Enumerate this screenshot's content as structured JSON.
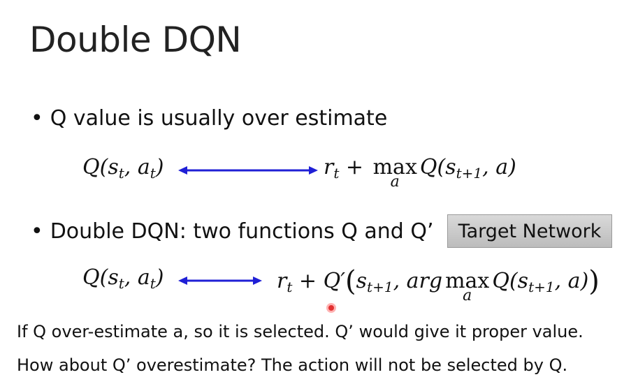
{
  "slide": {
    "title": "Double DQN",
    "bullet1": "Q value is usually over estimate",
    "bullet2": "Double DQN: two functions Q and Q’",
    "target_label": "Target Network",
    "note1": "If Q over-estimate a, so it is selected. Q’ would give it proper value.",
    "note2": "How about Q’ overestimate? The action will not be selected by Q.",
    "bullet_symbol": "•"
  },
  "eq1": {
    "lhs_Q": "Q(",
    "lhs_s": "s",
    "lhs_s_sub": "t",
    "lhs_sep": ", ",
    "lhs_a": "a",
    "lhs_a_sub": "t",
    "lhs_close": ")",
    "rhs_r": "r",
    "rhs_r_sub": "t",
    "rhs_plus": " + ",
    "rhs_max": "max",
    "rhs_max_under": "a",
    "rhs_Q": "Q(",
    "rhs_s": "s",
    "rhs_s_sub": "t+1",
    "rhs_sep": ", ",
    "rhs_a": "a",
    "rhs_close": ")"
  },
  "eq2": {
    "lhs_Q": "Q(",
    "lhs_s": "s",
    "lhs_s_sub": "t",
    "lhs_sep": ", ",
    "lhs_a": "a",
    "lhs_a_sub": "t",
    "lhs_close": ")",
    "rhs_r": "r",
    "rhs_r_sub": "t",
    "rhs_plus": " + ",
    "rhs_Qp": "Q′",
    "rhs_open": "(",
    "rhs_s": "s",
    "rhs_s_sub": "t+1",
    "rhs_sep": ", ",
    "rhs_arg": "arg",
    "rhs_max": "max",
    "rhs_max_under": "a",
    "rhs_Q": "Q(",
    "rhs_s2": "s",
    "rhs_s2_sub": "t+1",
    "rhs_sep2": ", ",
    "rhs_a": "a",
    "rhs_close1": ")",
    "rhs_close2": ")"
  },
  "colors": {
    "arrow": "#1f1fd6",
    "cursor": "#e23030"
  }
}
